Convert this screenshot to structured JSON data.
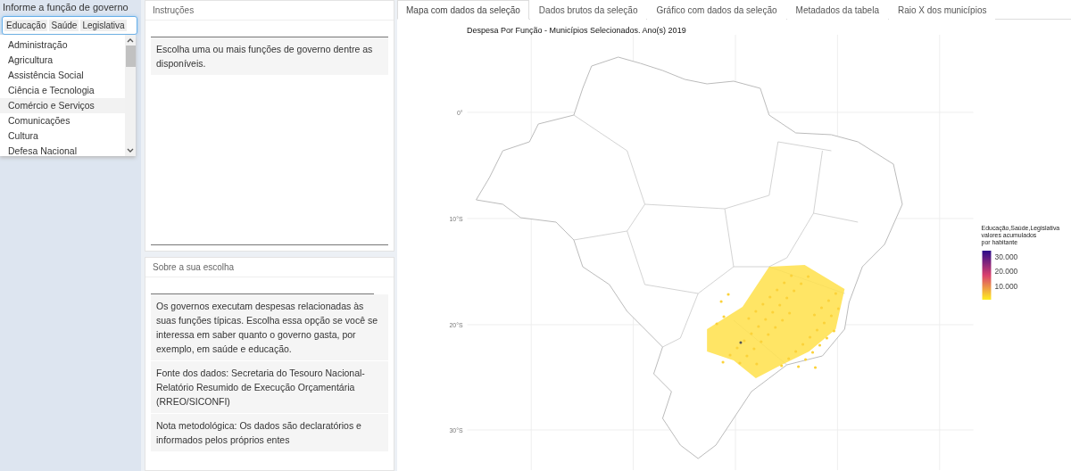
{
  "sidebar": {
    "label": "Informe a função de governo",
    "selected_tags": [
      "Educação",
      "Saúde",
      "Legislativa"
    ],
    "options": [
      {
        "label": "Administração",
        "highlighted": false
      },
      {
        "label": "Agricultura",
        "highlighted": false
      },
      {
        "label": "Assistência Social",
        "highlighted": false
      },
      {
        "label": "Ciência e Tecnologia",
        "highlighted": false
      },
      {
        "label": "Comércio e Serviços",
        "highlighted": true
      },
      {
        "label": "Comunicações",
        "highlighted": false
      },
      {
        "label": "Cultura",
        "highlighted": false
      },
      {
        "label": "Defesa Nacional",
        "highlighted": false
      }
    ]
  },
  "instructions": {
    "title": "Instruções",
    "text": "Escolha uma ou mais funções de governo dentre as disponíveis."
  },
  "about": {
    "title": "Sobre a sua escolha",
    "paragraphs": [
      "Os governos executam despesas relacionadas às suas funções típicas. Escolha essa opção se você se interessa em saber quanto o governo gasta, por exemplo, em saúde e educação.",
      "Fonte dos dados: Secretaria do Tesouro Nacional- Relatório Resumido de Execução Orçamentária (RREO/SICONFI)",
      "Nota metodológica: Os dados são declaratórios e informados pelos próprios entes"
    ]
  },
  "tabs": [
    {
      "label": "Mapa com dados da seleção",
      "selected": true
    },
    {
      "label": "Dados brutos da seleção",
      "selected": false
    },
    {
      "label": "Gráfico com dados da seleção",
      "selected": false
    },
    {
      "label": "Metadados da tabela",
      "selected": false
    },
    {
      "label": "Raio X dos municípios",
      "selected": false
    }
  ],
  "map": {
    "title": "Despesa Por Função - Municípios Selecionados. Ano(s) 2019",
    "lat_labels": [
      "0°",
      "10°S",
      "20°S",
      "30°S"
    ],
    "legend": {
      "title_lines": [
        "Educação,Saúde,Legislativa",
        "valores acumulados",
        "por habitante"
      ],
      "ticks": [
        "30.000",
        "20.000",
        "10.000"
      ]
    }
  }
}
